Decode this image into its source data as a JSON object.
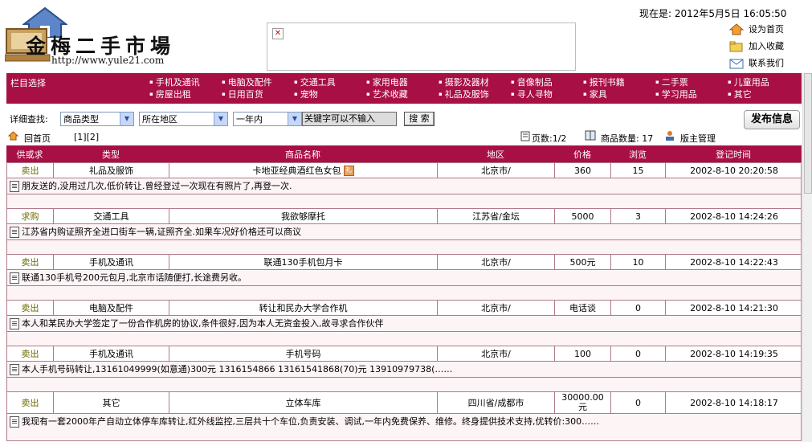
{
  "header": {
    "logo_text": "金梅二手市場",
    "logo_url": "http://www.yule21.com",
    "datetime": "现在是: 2012年5月5日  16:05:50",
    "links": [
      "设为首页",
      "加入收藏",
      "联系我们"
    ]
  },
  "category_bar": {
    "title": "栏目选择",
    "items": [
      "手机及通讯",
      "电脑及配件",
      "交通工具",
      "家用电器",
      "摄影及器材",
      "音像制品",
      "报刊书籍",
      "二手票",
      "儿童用品",
      "房屋出租",
      "日用百货",
      "宠物",
      "艺术收藏",
      "礼品及服饰",
      "寻人寻物",
      "家具",
      "学习用品",
      "其它"
    ]
  },
  "search": {
    "label": "详细查找:",
    "type_select": "商品类型",
    "region_select": "所在地区",
    "time_select": "一年内",
    "keyword_value": "关键字可以不输入",
    "search_button": "搜 索",
    "publish_button": "发布信息"
  },
  "nav": {
    "home": "回首页",
    "pages": "[1][2]",
    "page_count": "页数:1/2",
    "item_count": "商品数量: 17",
    "admin": "版主管理"
  },
  "table": {
    "headers": [
      "供或求",
      "类型",
      "商品名称",
      "地区",
      "价格",
      "浏览",
      "登记时间"
    ],
    "rows": [
      {
        "kind": "卖出",
        "type": "礼品及服饰",
        "name": "卡地亚经典酒红色女包",
        "region": "北京市/",
        "price": "360",
        "views": "15",
        "time": "2002-8-10 20:20:58",
        "desc": "朋友送的,没用过几次,低价转让.曾经登过一次现在有照片了,再登一次."
      },
      {
        "kind": "求购",
        "type": "交通工具",
        "name": "我欲够摩托",
        "region": "江苏省/金坛",
        "price": "5000",
        "views": "3",
        "time": "2002-8-10 14:24:26",
        "desc": "江苏省内购证照齐全进口街车一辆,证照齐全.如果车况好价格还可以商议"
      },
      {
        "kind": "卖出",
        "type": "手机及通讯",
        "name": "联通130手机包月卡",
        "region": "北京市/",
        "price": "500元",
        "views": "10",
        "time": "2002-8-10 14:22:43",
        "desc": "联通130手机号200元包月,北京市话随便打,长途费另收。"
      },
      {
        "kind": "卖出",
        "type": "电脑及配件",
        "name": "转让和民办大学合作机",
        "region": "北京市/",
        "price": "电话谈",
        "views": "0",
        "time": "2002-8-10 14:21:30",
        "desc": "本人和某民办大学签定了一份合作机房的协议,条件很好,因为本人无资金投入,故寻求合作伙伴"
      },
      {
        "kind": "卖出",
        "type": "手机及通讯",
        "name": "手机号码",
        "region": "北京市/",
        "price": "100",
        "views": "0",
        "time": "2002-8-10 14:19:35",
        "desc": "本人手机号码转让,13161049999(如意通)300元 1316154866 13161541868(70)元 13910979738(……"
      },
      {
        "kind": "卖出",
        "type": "其它",
        "name": "立体车库",
        "region": "四川省/成都市",
        "price": "30000.00元",
        "views": "0",
        "time": "2002-8-10 14:18:17",
        "desc": "我现有一套2000年产自动立体停车库转让,红外线监控,三层共十个车位,负责安装、调试,一年内免费保养、维修。终身提供技术支持,优转价:300……"
      }
    ]
  },
  "colors": {
    "accent": "#a80f45",
    "row_bg": "#fdf4f6",
    "sell": "#6d6a00"
  }
}
